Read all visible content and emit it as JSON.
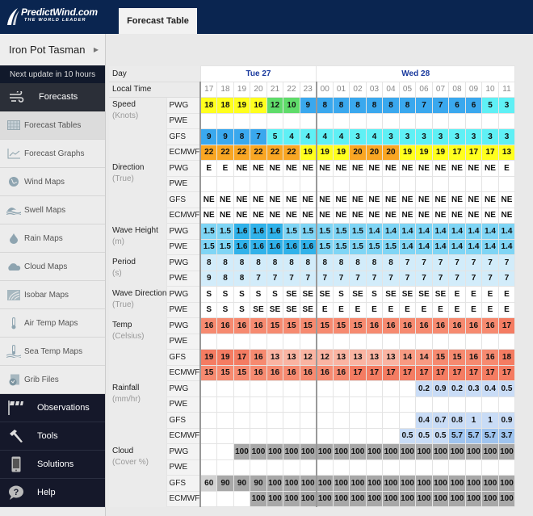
{
  "header": {
    "logo_brand": "PredictWind.com",
    "logo_tagline": "THE WORLD LEADER",
    "active_tab": "Forecast Table"
  },
  "sidebar": {
    "location": "Iron Pot Tasman",
    "next_update": "Next update in 10 hours",
    "section_forecasts": "Forecasts",
    "forecast_items": [
      {
        "label": "Forecast Tables",
        "icon": "table-icon",
        "active": true
      },
      {
        "label": "Forecast Graphs",
        "icon": "graph-icon",
        "active": false
      },
      {
        "label": "Wind Maps",
        "icon": "globe-icon",
        "active": false
      },
      {
        "label": "Swell Maps",
        "icon": "wave-icon",
        "active": false
      },
      {
        "label": "Rain Maps",
        "icon": "raindrop-icon",
        "active": false
      },
      {
        "label": "Cloud Maps",
        "icon": "cloud-icon",
        "active": false
      },
      {
        "label": "Isobar Maps",
        "icon": "isobar-icon",
        "active": false
      },
      {
        "label": "Air Temp Maps",
        "icon": "thermometer-icon",
        "active": false
      },
      {
        "label": "Sea Temp Maps",
        "icon": "sea-thermometer-icon",
        "active": false
      },
      {
        "label": "Grib Files",
        "icon": "grib-file-icon",
        "active": false
      }
    ],
    "sections": [
      {
        "label": "Observations",
        "icon": "flags-icon"
      },
      {
        "label": "Tools",
        "icon": "hammer-icon"
      },
      {
        "label": "Solutions",
        "icon": "phone-icon"
      },
      {
        "label": "Help",
        "icon": "help-bubble-icon"
      }
    ]
  },
  "table": {
    "day_label": "Day",
    "time_label": "Local Time",
    "days": [
      {
        "label": "Tue 27",
        "span": 7
      },
      {
        "label": "Wed 28",
        "span": 12
      }
    ],
    "times": [
      "17",
      "18",
      "19",
      "20",
      "21",
      "22",
      "23",
      "00",
      "01",
      "02",
      "03",
      "04",
      "05",
      "06",
      "07",
      "08",
      "09",
      "10",
      "11"
    ],
    "groups": [
      {
        "name": "Speed",
        "unit": "(Knots)",
        "kind": "speed",
        "rows": [
          {
            "model": "PWG",
            "values": [
              "18",
              "18",
              "19",
              "16",
              "12",
              "10",
              "9",
              "8",
              "8",
              "8",
              "8",
              "8",
              "8",
              "7",
              "7",
              "6",
              "6",
              "5",
              "3"
            ]
          },
          {
            "model": "PWE",
            "values": [
              "",
              "",
              "",
              "",
              "",
              "",
              "",
              "",
              "",
              "",
              "",
              "",
              "",
              "",
              "",
              "",
              "",
              "",
              ""
            ]
          },
          {
            "model": "GFS",
            "values": [
              "9",
              "9",
              "8",
              "7",
              "5",
              "4",
              "4",
              "4",
              "4",
              "3",
              "4",
              "3",
              "3",
              "3",
              "3",
              "3",
              "3",
              "3",
              "3"
            ]
          },
          {
            "model": "ECMWF",
            "values": [
              "22",
              "22",
              "22",
              "22",
              "22",
              "22",
              "19",
              "19",
              "19",
              "20",
              "20",
              "20",
              "19",
              "19",
              "19",
              "17",
              "17",
              "17",
              "13"
            ]
          }
        ]
      },
      {
        "name": "Direction",
        "unit": "(True)",
        "kind": "plain",
        "rows": [
          {
            "model": "PWG",
            "values": [
              "E",
              "E",
              "NE",
              "NE",
              "NE",
              "NE",
              "NE",
              "NE",
              "NE",
              "NE",
              "NE",
              "NE",
              "NE",
              "NE",
              "NE",
              "NE",
              "NE",
              "NE",
              "E"
            ]
          },
          {
            "model": "PWE",
            "values": [
              "",
              "",
              "",
              "",
              "",
              "",
              "",
              "",
              "",
              "",
              "",
              "",
              "",
              "",
              "",
              "",
              "",
              "",
              ""
            ]
          },
          {
            "model": "GFS",
            "values": [
              "NE",
              "NE",
              "NE",
              "NE",
              "NE",
              "NE",
              "NE",
              "NE",
              "NE",
              "NE",
              "NE",
              "NE",
              "NE",
              "NE",
              "NE",
              "NE",
              "NE",
              "NE",
              "NE"
            ]
          },
          {
            "model": "ECMWF",
            "values": [
              "NE",
              "NE",
              "NE",
              "NE",
              "NE",
              "NE",
              "NE",
              "NE",
              "NE",
              "NE",
              "NE",
              "NE",
              "NE",
              "NE",
              "NE",
              "NE",
              "NE",
              "NE",
              "NE"
            ]
          }
        ]
      },
      {
        "name": "Wave Height",
        "unit": "(m)",
        "kind": "wave",
        "rows": [
          {
            "model": "PWG",
            "values": [
              "1.5",
              "1.5",
              "1.6",
              "1.6",
              "1.6",
              "1.5",
              "1.5",
              "1.5",
              "1.5",
              "1.5",
              "1.4",
              "1.4",
              "1.4",
              "1.4",
              "1.4",
              "1.4",
              "1.4",
              "1.4",
              "1.4"
            ]
          },
          {
            "model": "PWE",
            "values": [
              "1.5",
              "1.5",
              "1.6",
              "1.6",
              "1.6",
              "1.6",
              "1.6",
              "1.5",
              "1.5",
              "1.5",
              "1.5",
              "1.5",
              "1.4",
              "1.4",
              "1.4",
              "1.4",
              "1.4",
              "1.4",
              "1.4"
            ]
          }
        ]
      },
      {
        "name": "Period",
        "unit": "(s)",
        "kind": "period",
        "rows": [
          {
            "model": "PWG",
            "values": [
              "8",
              "8",
              "8",
              "8",
              "8",
              "8",
              "8",
              "8",
              "8",
              "8",
              "8",
              "8",
              "7",
              "7",
              "7",
              "7",
              "7",
              "7",
              "7"
            ]
          },
          {
            "model": "PWE",
            "values": [
              "9",
              "8",
              "8",
              "7",
              "7",
              "7",
              "7",
              "7",
              "7",
              "7",
              "7",
              "7",
              "7",
              "7",
              "7",
              "7",
              "7",
              "7",
              "7"
            ]
          }
        ]
      },
      {
        "name": "Wave Direction",
        "unit": "(True)",
        "kind": "plain",
        "rows": [
          {
            "model": "PWG",
            "values": [
              "S",
              "S",
              "S",
              "S",
              "S",
              "SE",
              "SE",
              "SE",
              "S",
              "SE",
              "S",
              "SE",
              "SE",
              "SE",
              "SE",
              "E",
              "E",
              "E",
              "E"
            ]
          },
          {
            "model": "PWE",
            "values": [
              "S",
              "S",
              "S",
              "SE",
              "SE",
              "SE",
              "SE",
              "E",
              "E",
              "E",
              "E",
              "E",
              "E",
              "E",
              "E",
              "E",
              "E",
              "E",
              "E"
            ]
          }
        ]
      },
      {
        "name": "Temp",
        "unit": "(Celsius)",
        "kind": "temp",
        "rows": [
          {
            "model": "PWG",
            "values": [
              "16",
              "16",
              "16",
              "16",
              "15",
              "15",
              "15",
              "15",
              "15",
              "15",
              "16",
              "16",
              "16",
              "16",
              "16",
              "16",
              "16",
              "16",
              "17"
            ]
          },
          {
            "model": "PWE",
            "values": [
              "",
              "",
              "",
              "",
              "",
              "",
              "",
              "",
              "",
              "",
              "",
              "",
              "",
              "",
              "",
              "",
              "",
              "",
              ""
            ]
          },
          {
            "model": "GFS",
            "values": [
              "19",
              "19",
              "17",
              "16",
              "13",
              "13",
              "12",
              "12",
              "13",
              "13",
              "13",
              "13",
              "14",
              "14",
              "15",
              "15",
              "16",
              "16",
              "18"
            ]
          },
          {
            "model": "ECMWF",
            "values": [
              "15",
              "15",
              "15",
              "16",
              "16",
              "16",
              "16",
              "16",
              "16",
              "17",
              "17",
              "17",
              "17",
              "17",
              "17",
              "17",
              "17",
              "17",
              "17"
            ]
          }
        ]
      },
      {
        "name": "Rainfall",
        "unit": "(mm/hr)",
        "kind": "rain",
        "rows": [
          {
            "model": "PWG",
            "values": [
              "",
              "",
              "",
              "",
              "",
              "",
              "",
              "",
              "",
              "",
              "",
              "",
              "",
              "0.2",
              "0.9",
              "0.2",
              "0.3",
              "0.4",
              "0.5"
            ]
          },
          {
            "model": "PWE",
            "values": [
              "",
              "",
              "",
              "",
              "",
              "",
              "",
              "",
              "",
              "",
              "",
              "",
              "",
              "",
              "",
              "",
              "",
              "",
              ""
            ]
          },
          {
            "model": "GFS",
            "values": [
              "",
              "",
              "",
              "",
              "",
              "",
              "",
              "",
              "",
              "",
              "",
              "",
              "",
              "0.4",
              "0.7",
              "0.8",
              "1",
              "1",
              "0.9"
            ]
          },
          {
            "model": "ECMWF",
            "values": [
              "",
              "",
              "",
              "",
              "",
              "",
              "",
              "",
              "",
              "",
              "",
              "",
              "0.5",
              "0.5",
              "0.5",
              "5.7",
              "5.7",
              "5.7",
              "3.7"
            ]
          }
        ]
      },
      {
        "name": "Cloud",
        "unit": "(Cover %)",
        "kind": "cloud",
        "rows": [
          {
            "model": "PWG",
            "values": [
              "",
              "",
              "100",
              "100",
              "100",
              "100",
              "100",
              "100",
              "100",
              "100",
              "100",
              "100",
              "100",
              "100",
              "100",
              "100",
              "100",
              "100",
              "100"
            ]
          },
          {
            "model": "PWE",
            "values": [
              "",
              "",
              "",
              "",
              "",
              "",
              "",
              "",
              "",
              "",
              "",
              "",
              "",
              "",
              "",
              "",
              "",
              "",
              ""
            ]
          },
          {
            "model": "GFS",
            "values": [
              "60",
              "90",
              "90",
              "90",
              "100",
              "100",
              "100",
              "100",
              "100",
              "100",
              "100",
              "100",
              "100",
              "100",
              "100",
              "100",
              "100",
              "100",
              "100"
            ]
          },
          {
            "model": "ECMWF",
            "values": [
              "",
              "",
              "",
              "100",
              "100",
              "100",
              "100",
              "100",
              "100",
              "100",
              "100",
              "100",
              "100",
              "100",
              "100",
              "100",
              "100",
              "100",
              "100"
            ]
          }
        ]
      }
    ]
  },
  "colors": {
    "header_bg": "#0a2550",
    "day_text": "#1a3a9e",
    "speed_yellow": "#ffff1e",
    "speed_green": "#5fdc6a",
    "speed_blue": "#3aa8ee",
    "speed_cyan": "#5ff0f5",
    "speed_orange": "#f9a623",
    "wave_light": "#7fd5f5",
    "wave_dark": "#30b2ea",
    "period_bg": "#d2ecfa",
    "temp_bg": "#f68a70",
    "cloud_bg": "#a8a8a8"
  }
}
